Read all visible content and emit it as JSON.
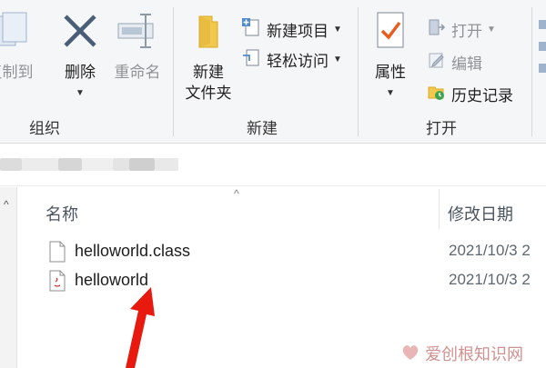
{
  "ribbon": {
    "organize": {
      "group_label": "组织",
      "copy_to_label": "复制到",
      "delete_label": "删除",
      "rename_label": "重命名"
    },
    "new": {
      "group_label": "新建",
      "new_folder_label_line1": "新建",
      "new_folder_label_line2": "文件夹",
      "new_item_label": "新建项目",
      "easy_access_label": "轻松访问"
    },
    "open": {
      "group_label": "打开",
      "properties_label": "属性",
      "open_label": "打开",
      "edit_label": "编辑",
      "history_label": "历史记录"
    }
  },
  "file_list": {
    "columns": {
      "name": "名称",
      "date_modified": "修改日期"
    },
    "files": [
      {
        "name": "helloworld.class",
        "date": "2021/10/3 2",
        "type_icon": "generic-file-icon"
      },
      {
        "name": "helloworld",
        "date": "2021/10/3 2",
        "type_icon": "java-file-icon"
      }
    ]
  },
  "watermark": "爱创根知识网",
  "colors": {
    "ribbon_bg": "#f5f6f7",
    "arrow": "#e8190f",
    "folder": "#f2c94c",
    "delete_x": "#4a5d78"
  }
}
